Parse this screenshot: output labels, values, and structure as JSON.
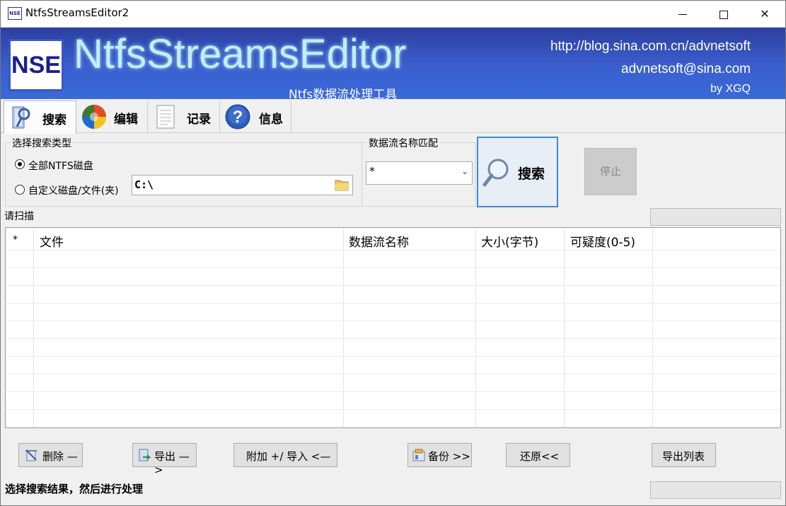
{
  "window": {
    "title": "NtfsStreamsEditor2",
    "icon_text": "NSE",
    "controls": [
      "minimize-icon",
      "maximize-icon",
      "close-icon"
    ]
  },
  "banner": {
    "logo": "NSE",
    "title": "NtfsStreamsEditor",
    "subtitle": "Ntfs数据流处理工具",
    "url": "http://blog.sina.com.cn/advnetsoft",
    "email": "advnetsoft@sina.com",
    "author": "by XGQ"
  },
  "tabs": [
    {
      "label": "搜索",
      "icon": "search-tab-icon",
      "active": true
    },
    {
      "label": "编辑",
      "icon": "edit-tab-icon",
      "active": false
    },
    {
      "label": "记录",
      "icon": "log-tab-icon",
      "active": false
    },
    {
      "label": "信息",
      "icon": "info-tab-icon",
      "active": false
    }
  ],
  "search_type": {
    "label": "选择搜索类型",
    "option_all": "全部NTFS磁盘",
    "option_custom": "自定义磁盘/文件(夹)",
    "selected": "option_all",
    "path_value": "C:\\"
  },
  "stream_match": {
    "label": "数据流名称匹配",
    "value": "*"
  },
  "buttons": {
    "search": "搜索",
    "stop": "停止",
    "delete": "删除 —",
    "export": "导出 —>",
    "attach_import": "附加 +/ 导入 <—",
    "backup": "备份 >>",
    "restore": "还原<<",
    "export_list": "导出列表"
  },
  "status": {
    "top": "请扫描",
    "bottom": "选择搜索结果，然后进行处理"
  },
  "table": {
    "columns": [
      "*",
      "文件",
      "数据流名称",
      "大小(字节)",
      "可疑度(0-5)"
    ],
    "rows": []
  },
  "colors": {
    "banner_top": "#2c3fa0",
    "banner_bottom": "#3a6ad8",
    "search_button_border": "#3c8ad8"
  }
}
